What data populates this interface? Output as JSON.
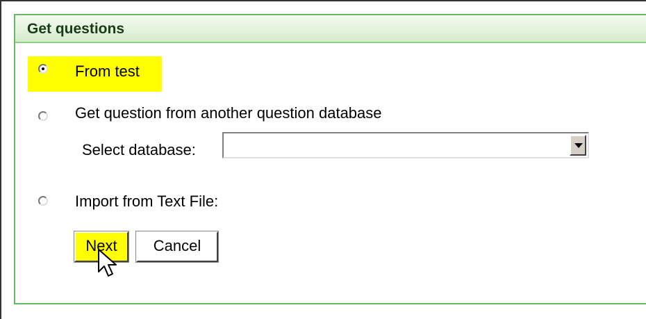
{
  "panel": {
    "title": "Get questions",
    "header_color": "#e3f3dc",
    "border_color": "#66b866"
  },
  "options": [
    {
      "id": "from-test",
      "label": "From test",
      "selected": true,
      "highlighted": true
    },
    {
      "id": "another-database",
      "label": "Get question from another question database",
      "selected": false,
      "highlighted": false
    },
    {
      "id": "import-text-file",
      "label": "Import from Text File:",
      "selected": false,
      "highlighted": false
    }
  ],
  "database_select": {
    "label": "Select database:",
    "value": ""
  },
  "buttons": {
    "next": "Next",
    "cancel": "Cancel"
  },
  "colors": {
    "highlight": "#ffff00"
  },
  "icons": {
    "cursor": "arrow-pointer-icon",
    "select_arrow": "triangle-down-icon"
  }
}
